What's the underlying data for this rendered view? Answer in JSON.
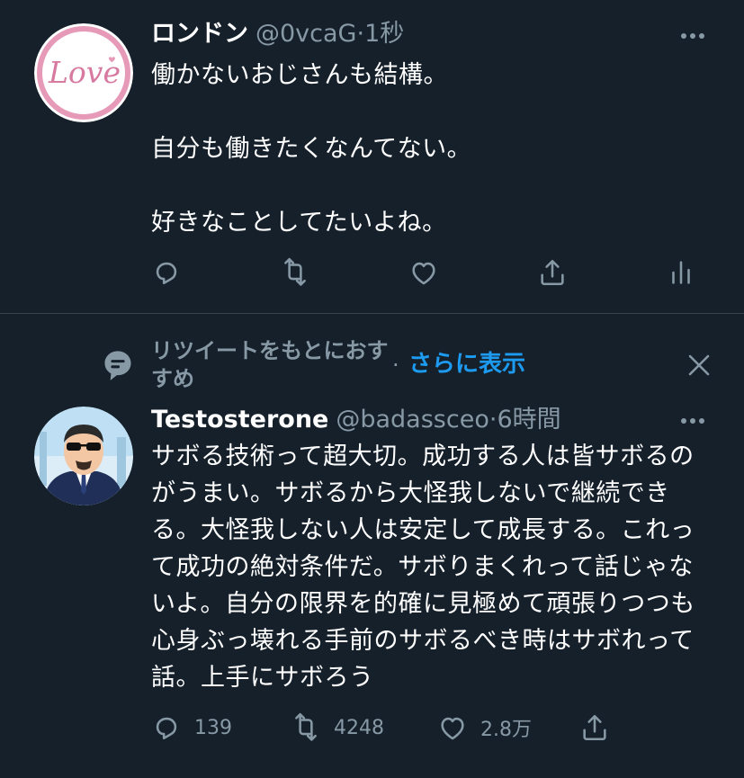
{
  "tweets": [
    {
      "name": "ロンドン",
      "handle": "@0vcaG",
      "separator": "·",
      "time": "1秒",
      "avatar_text": "Love",
      "paragraphs": [
        "働かないおじさんも結構。",
        "自分も働きたくなんてない。",
        "好きなことしてたいよね。"
      ]
    },
    {
      "context": {
        "label": "リツイートをもとにおすすめ",
        "separator": "·",
        "link": "さらに表示"
      },
      "name": "Testosterone",
      "handle": "@badassceo",
      "separator": "·",
      "time": "6時間",
      "paragraphs": [
        "サボる技術って超大切。成功する人は皆サボるのがうまい。サボるから大怪我しないで継続できる。大怪我しない人は安定して成長する。これって成功の絶対条件だ。サボりまくれって話じゃないよ。自分の限界を的確に見極めて頑張りつつも心身ぶっ壊れる手前のサボるべき時はサボれって話。上手にサボろう"
      ],
      "stats": {
        "replies": "139",
        "retweets": "4248",
        "likes": "2.8万"
      }
    }
  ],
  "colors": {
    "background": "#15202b",
    "text": "#ffffff",
    "secondary": "#8899a6",
    "link": "#1d9bf0",
    "divider": "#38444d",
    "avatar_pink": "#e69ab8"
  }
}
